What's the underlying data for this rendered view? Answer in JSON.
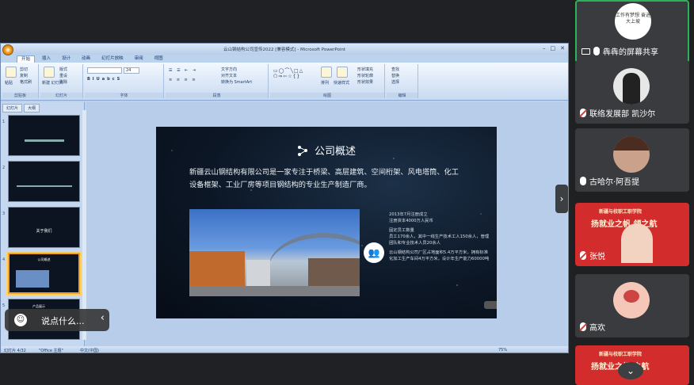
{
  "window": {
    "title": "云山钢结构公司宣传2022 [兼容模式] - Microsoft PowerPoint",
    "ribbon_tabs": [
      "开始",
      "插入",
      "设计",
      "动画",
      "幻灯片放映",
      "审阅",
      "视图"
    ],
    "groups": [
      "剪贴板",
      "幻灯片",
      "字体",
      "段落",
      "绘图",
      "编辑"
    ],
    "buttons": {
      "paste": "粘贴",
      "new_slide": "新建\n幻灯片",
      "layout": "版式",
      "reset": "重设",
      "delete": "删除",
      "cut": "剪切",
      "copy": "复制",
      "format_painter": "格式刷",
      "arrange": "排列",
      "quick_styles": "快速样式",
      "find": "查找",
      "replace": "替换",
      "select": "选择",
      "text_direction": "文字方向",
      "align_text": "对齐文本",
      "smartart": "转换为 SmartArt",
      "shape_fill": "形状填充",
      "shape_outline": "形状轮廓",
      "shape_effects": "形状效果"
    },
    "font_size": "24"
  },
  "panel": {
    "tabs": [
      "幻灯片",
      "大纲"
    ],
    "thumbs": [
      {
        "num": "1",
        "caption": ""
      },
      {
        "num": "2",
        "caption": ""
      },
      {
        "num": "3",
        "caption": "关于我们"
      },
      {
        "num": "4",
        "caption": "公司概述"
      },
      {
        "num": "5",
        "caption": "产品展示"
      }
    ]
  },
  "slide": {
    "title": "公司概述",
    "body": "新疆云山钢结构有限公司是一家专注于桥梁、高层建筑、空间桁架、风电塔筒、化工设备框架、工业厂房等项目钢结构的专业生产制造厂商。",
    "facts": [
      "2013年7月注册成立\n注册资本4000万人民币",
      "固定员工数量\n员工170余人，其中一线生产技术工人150余人，管理团队和专业技术人员20余人",
      "云山钢结构公司厂区占地面积5.4万平方米，拥有标准化加工生产车间4万平方米，设计年生产能力60000吨"
    ]
  },
  "statusbar": {
    "slide_count": "幻灯片 4/32",
    "theme": "\"Office 主题\"",
    "lang": "中文(中国)",
    "zoom": "75%"
  },
  "chat": {
    "placeholder": "说点什么..."
  },
  "participants": [
    {
      "name": "犇犇的屏幕共享",
      "avatar_text": "工作有梦想 奋进大上坡",
      "mic": "on",
      "sharing": true
    },
    {
      "name": "联络发展部 凯沙尔",
      "mic": "off"
    },
    {
      "name": "古哈尔·阿吾提",
      "mic": "on"
    },
    {
      "name": "张悦",
      "mic": "off",
      "banner_l1": "新疆与校职工职学院",
      "banner_l2": "扬就业之帆 领之航"
    },
    {
      "name": "高欢",
      "mic": "off"
    },
    {
      "name": "",
      "banner_l1": "新疆与校职工职学院",
      "banner_l2": "扬就业之帆 之航"
    }
  ]
}
